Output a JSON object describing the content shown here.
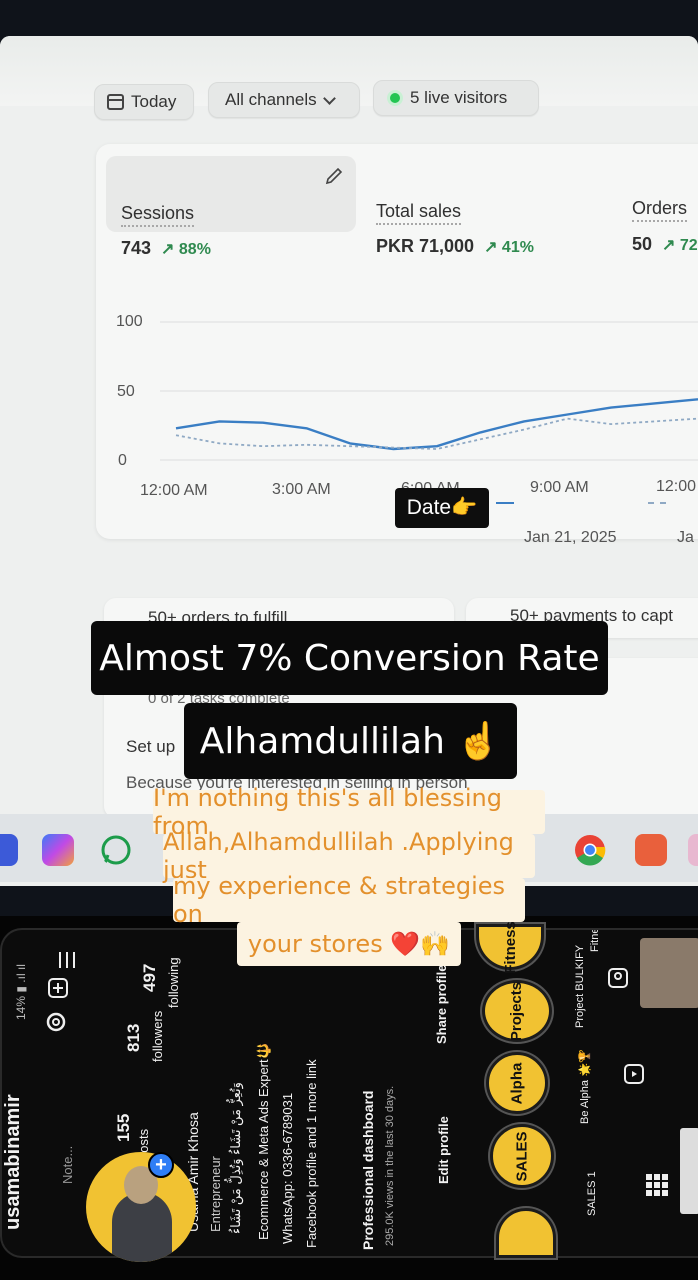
{
  "toolbar": {
    "today_label": "Today",
    "channels_label": "All channels",
    "visitors_label": "5 live visitors"
  },
  "metrics": [
    {
      "label": "Sessions",
      "value": "743",
      "change": "↗ 88%"
    },
    {
      "label": "Total sales",
      "value": "PKR 71,000",
      "change": "↗ 41%"
    },
    {
      "label": "Orders",
      "value": "50",
      "change": "↗ 72"
    }
  ],
  "chart_data": {
    "type": "line",
    "x_ticks": [
      "12:00 AM",
      "3:00 AM",
      "6:00 AM",
      "9:00 AM",
      "12:00"
    ],
    "y_ticks": [
      "100",
      "50",
      "0"
    ],
    "ylim": [
      0,
      100
    ],
    "series": [
      {
        "name": "Jan 21, 2025",
        "style": "solid",
        "color": "#3a7ec4",
        "x": [
          "12:00 AM",
          "1:00 AM",
          "2:00 AM",
          "3:00 AM",
          "4:00 AM",
          "5:00 AM",
          "6:00 AM",
          "7:00 AM",
          "8:00 AM",
          "9:00 AM",
          "10:00 AM",
          "11:00 AM",
          "12:00 PM"
        ],
        "values": [
          23,
          28,
          27,
          23,
          12,
          8,
          10,
          20,
          28,
          33,
          38,
          41,
          44
        ]
      },
      {
        "name": "Ja",
        "style": "dashed",
        "color": "#8fa9c4",
        "x": [
          "12:00 AM",
          "1:00 AM",
          "2:00 AM",
          "3:00 AM",
          "4:00 AM",
          "5:00 AM",
          "6:00 AM",
          "7:00 AM",
          "8:00 AM",
          "9:00 AM",
          "10:00 AM",
          "11:00 AM",
          "12:00 PM"
        ],
        "values": [
          18,
          12,
          10,
          11,
          10,
          9,
          8,
          15,
          22,
          30,
          26,
          28,
          30
        ]
      }
    ]
  },
  "date_tag": "Date👉",
  "legend": {
    "primary": "Jan 21, 2025",
    "secondary": "Ja"
  },
  "tasks": {
    "orders_to_fulfill": "50+ orders to fulfill",
    "payments_to_capture": "50+ payments to capt",
    "tasks_complete": "0 of 2 tasks complete",
    "setup": "Set up",
    "because": "Because you're interested in selling in person"
  },
  "overlays": {
    "headline": "Almost 7% Conversion Rate",
    "alhamdulillah": "Alhamdullilah ☝️",
    "blessing_lines": [
      "I'm nothing this's all blessing from",
      "Allah,Alhamdullilah .Applying just",
      "my experience & strategies on",
      "your stores ❤️🙌"
    ]
  },
  "profile": {
    "username": "usamabinamir",
    "note": "Note...",
    "posts": "155",
    "posts_label": "posts",
    "followers": "813",
    "followers_label": "followers",
    "following": "497",
    "following_label": "following",
    "name": "Usama Amir Khosa",
    "role": "Entrepreneur",
    "bio_arabic": "وَتُعِزُّ مَنْ تَشَاءُ وَتُذِلُّ مَنْ تَشَاءُ",
    "bio_1": "Ecommerce & Meta Ads Expert🔱",
    "bio_2": "WhatsApp: 0336-6789031",
    "bio_3": "Facebook profile and 1 more link",
    "dashboard_title": "Professional dashboard",
    "dashboard_sub": "295.0K views in the last 30 days.",
    "edit_profile": "Edit profile",
    "share_profile": "Share profile",
    "status_bar": "14% ▮ .ıl ıl",
    "highlights": [
      "SALES",
      "Alpha",
      "Projects",
      "Fitness"
    ],
    "highlight_captions": [
      "SALES 1",
      "Be Alpha 🌟🏆",
      "Project BULKIFY",
      "Fitness 💪"
    ]
  }
}
